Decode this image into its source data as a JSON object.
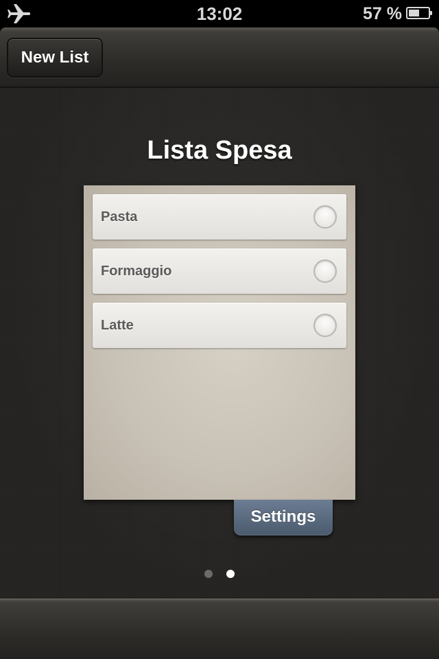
{
  "status_bar": {
    "icon": "airplane-icon",
    "time": "13:02",
    "battery_percent": "57 %",
    "battery_icon": "battery-icon",
    "battery_level": 0.57
  },
  "nav_bar": {
    "new_list_label": "New List"
  },
  "list": {
    "title": "Lista Spesa",
    "items": [
      {
        "label": "Pasta",
        "checked": false
      },
      {
        "label": "Formaggio",
        "checked": false
      },
      {
        "label": "Latte",
        "checked": false
      }
    ]
  },
  "settings_label": "Settings",
  "pager": {
    "pages": 2,
    "current": 2
  },
  "colors": {
    "background": "#252422",
    "card": "#c9c2b6",
    "settings_tab": "#5b6b80",
    "text_white": "#ffffff"
  }
}
